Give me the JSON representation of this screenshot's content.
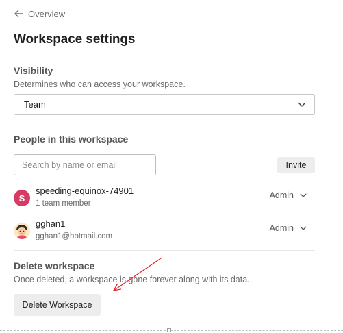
{
  "nav": {
    "back_label": "Overview"
  },
  "page": {
    "title": "Workspace settings"
  },
  "visibility": {
    "title": "Visibility",
    "description": "Determines who can access your workspace.",
    "selected": "Team"
  },
  "people": {
    "title": "People in this workspace",
    "search_placeholder": "Search by name or email",
    "invite_label": "Invite",
    "members": [
      {
        "avatar_letter": "S",
        "avatar_color": "#d73a62",
        "name": "speeding-equinox-74901",
        "subtitle": "1 team member",
        "role": "Admin"
      },
      {
        "avatar_icon": "user-avatar-icon",
        "name": "gghan1",
        "subtitle": "gghan1@hotmail.com",
        "role": "Admin"
      }
    ]
  },
  "delete": {
    "title": "Delete workspace",
    "description": "Once deleted, a workspace is gone forever along with its data.",
    "button_label": "Delete Workspace"
  },
  "annotation": {
    "arrow_color": "#e0282e"
  }
}
